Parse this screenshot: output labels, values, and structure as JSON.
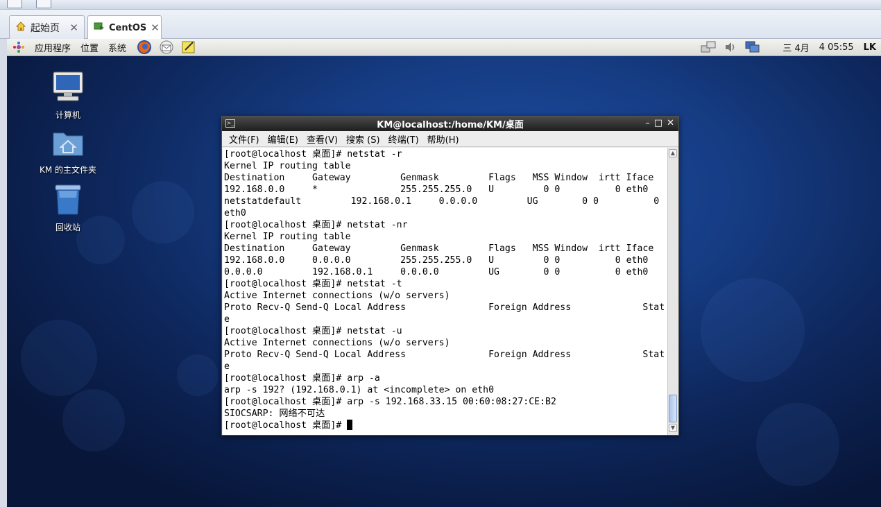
{
  "browser": {
    "tabs": [
      {
        "label": "起始页",
        "icon": "home-icon",
        "close": "✕"
      },
      {
        "label": "CentOS",
        "icon": "vm-icon",
        "close": "✕"
      }
    ]
  },
  "panel": {
    "menus": [
      "应用程序",
      "位置",
      "系统"
    ],
    "clock": {
      "weekday": "三 4月",
      "day_time": "4 05:55"
    },
    "user": "LK"
  },
  "desktop": {
    "icons": [
      {
        "label": "计算机",
        "icon": "computer-icon"
      },
      {
        "label": "KM 的主文件夹",
        "icon": "home-folder-icon"
      },
      {
        "label": "回收站",
        "icon": "trash-icon"
      }
    ]
  },
  "terminal": {
    "title": "KM@localhost:/home/KM/桌面",
    "controls": {
      "minimize": "–",
      "maximize": "□",
      "close": "✕"
    },
    "menus": [
      "文件(F)",
      "编辑(E)",
      "查看(V)",
      "搜索 (S)",
      "终端(T)",
      "帮助(H)"
    ],
    "lines": [
      "[root@localhost 桌面]# netstat -r",
      "Kernel IP routing table",
      "Destination     Gateway         Genmask         Flags   MSS Window  irtt Iface",
      "192.168.0.0     *               255.255.255.0   U         0 0          0 eth0",
      "netstatdefault         192.168.0.1     0.0.0.0         UG        0 0          0",
      "eth0",
      "[root@localhost 桌面]# netstat -nr",
      "Kernel IP routing table",
      "Destination     Gateway         Genmask         Flags   MSS Window  irtt Iface",
      "192.168.0.0     0.0.0.0         255.255.255.0   U         0 0          0 eth0",
      "0.0.0.0         192.168.0.1     0.0.0.0         UG        0 0          0 eth0",
      "[root@localhost 桌面]# netstat -t",
      "Active Internet connections (w/o servers)",
      "Proto Recv-Q Send-Q Local Address               Foreign Address             Stat",
      "e",
      "[root@localhost 桌面]# netstat -u",
      "Active Internet connections (w/o servers)",
      "Proto Recv-Q Send-Q Local Address               Foreign Address             Stat",
      "e",
      "[root@localhost 桌面]# arp -a",
      "arp -s 192? (192.168.0.1) at <incomplete> on eth0",
      "[root@localhost 桌面]# arp -s 192.168.33.15 00:60:08:27:CE:B2",
      "SIOCSARP: 网络不可达"
    ],
    "prompt": "[root@localhost 桌面]# "
  }
}
